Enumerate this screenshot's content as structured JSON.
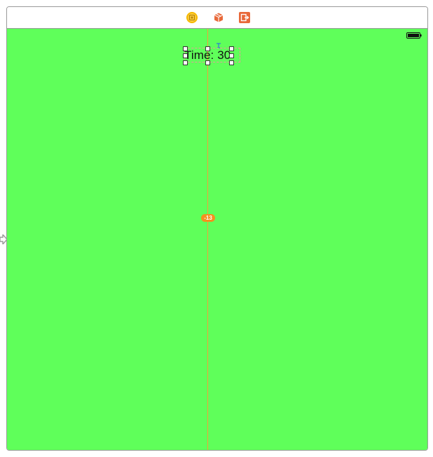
{
  "scene_dock": {
    "icons": [
      {
        "name": "view-controller-icon",
        "color": "#f5b800"
      },
      {
        "name": "first-responder-icon",
        "color": "#e8693a"
      },
      {
        "name": "exit-icon",
        "color": "#e8693a"
      }
    ]
  },
  "view": {
    "background_color": "#5fff5a",
    "status_bar": {
      "battery": "battery-icon"
    }
  },
  "label": {
    "text": "Time: 30"
  },
  "constraint": {
    "badge_text": "-13",
    "color": "#f5901e"
  },
  "guide": {
    "color": "#f2a33a"
  },
  "entry_point": {
    "icon": "entry-arrow-icon"
  }
}
